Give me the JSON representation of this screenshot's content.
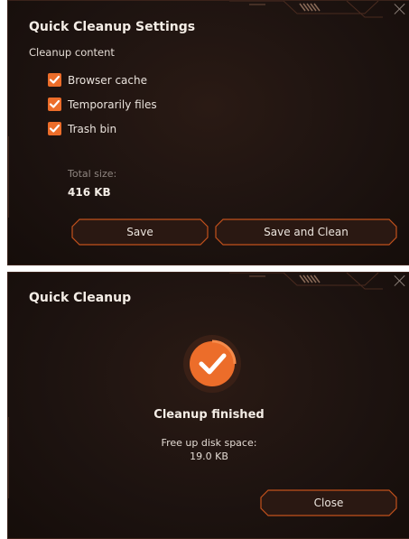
{
  "settings_dialog": {
    "title": "Quick Cleanup Settings",
    "section_label": "Cleanup content",
    "options": [
      {
        "label": "Browser cache",
        "checked": true
      },
      {
        "label": "Temporarily files",
        "checked": true
      },
      {
        "label": "Trash bin",
        "checked": true
      }
    ],
    "total_size_label": "Total size:",
    "total_size_value": "416 KB",
    "save_label": "Save",
    "save_and_clean_label": "Save and Clean"
  },
  "result_dialog": {
    "title": "Quick Cleanup",
    "status": "Cleanup finished",
    "freed_label": "Free up disk space:",
    "freed_value": "19.0 KB",
    "close_label": "Close"
  },
  "colors": {
    "accent": "#ec6d2a",
    "panel_bg": "#1d1310",
    "button_border": "#c2511c"
  },
  "icons": [
    "close-icon",
    "checkmark-icon",
    "success-check-icon"
  ]
}
